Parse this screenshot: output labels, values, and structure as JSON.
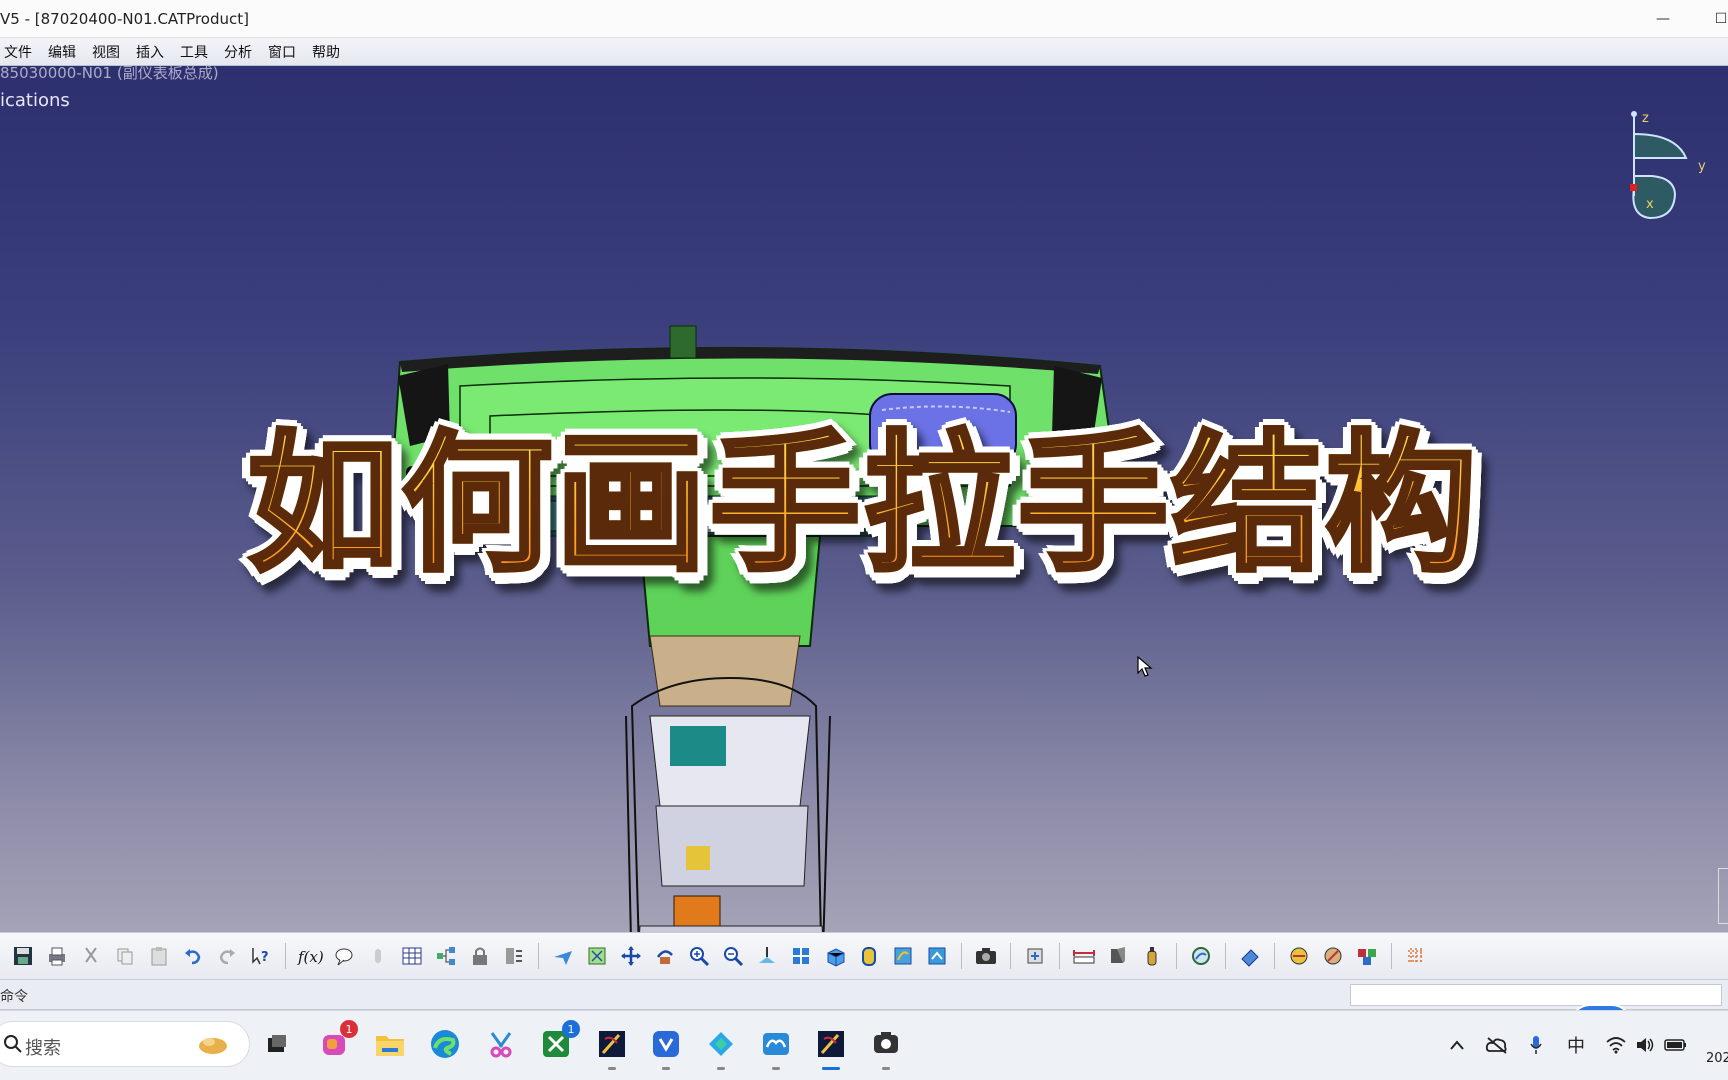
{
  "window": {
    "title": "V5 - [87020400-N01.CATProduct]",
    "minimize_glyph": "—",
    "maximize_glyph": "☐"
  },
  "menu": [
    "文件",
    "编辑",
    "视图",
    "插入",
    "工具",
    "分析",
    "窗口",
    "帮助"
  ],
  "tree": {
    "root_text": "85030000-N01 (副仪表板总成)",
    "applications_text": "ications"
  },
  "compass": {
    "axis_z": "z",
    "axis_y": "y",
    "axis_x": "x"
  },
  "overlay": {
    "title": "如何画手拉手结构"
  },
  "toolbar": {
    "icons": [
      "save-icon",
      "print-icon",
      "cut-icon",
      "copy-icon",
      "paste-icon",
      "undo-icon",
      "redo-icon",
      "whats-this-icon",
      "formula-icon",
      "comment-icon",
      "knowledge-icon",
      "table-icon",
      "tree-icon",
      "lock-icon",
      "catalog-icon",
      "fly-mode-icon",
      "fit-all-icon",
      "pan-icon",
      "rotate-icon",
      "zoom-in-icon",
      "zoom-out-icon",
      "normal-view-icon",
      "multi-view-icon",
      "iso-view-icon",
      "shading-icon",
      "hide-show-icon",
      "swap-space-icon",
      "capture-icon",
      "update-icon",
      "measure-icon",
      "manipulate-icon",
      "clash-icon",
      "sectioning-icon",
      "eraser-icon",
      "render-icon",
      "apply-material-icon",
      "color-icon",
      "grid-icon"
    ]
  },
  "status": {
    "label": "命令"
  },
  "taskbar": {
    "search_placeholder": "搜索",
    "badge_copilot": "1",
    "badge_xbox": "1",
    "ime": "中",
    "clock": "202"
  },
  "colors": {
    "viewport_top": "#2d2f6e",
    "viewport_bottom": "#a5a3b7",
    "model_green": "#6fe06a",
    "title_gold": "#ffb22a",
    "title_stroke": "#5a2a0a"
  }
}
